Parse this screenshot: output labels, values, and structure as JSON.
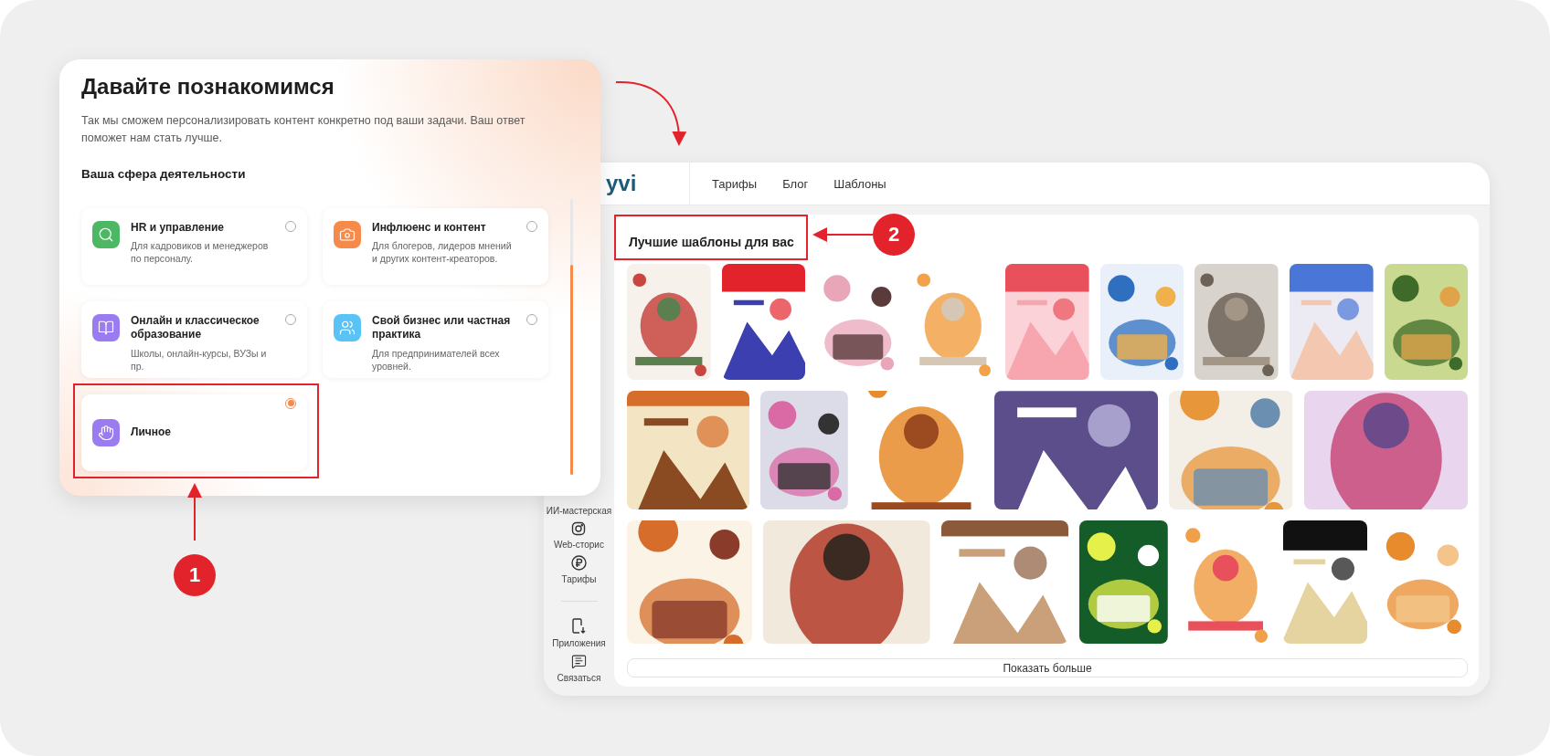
{
  "onboarding": {
    "title": "Давайте познакомимся",
    "subtitle": "Так мы сможем персонализировать контент конкретно под ваши задачи. Ваш ответ поможет нам стать лучше.",
    "section_title": "Ваша сфера деятельности",
    "options": [
      {
        "title": "HR и управление",
        "description": "Для кадровиков и менеджеров по персоналу.",
        "selected": false
      },
      {
        "title": "Инфлюенс и контент",
        "description": "Для блогеров, лидеров мнений и других контент-креаторов.",
        "selected": false
      },
      {
        "title": "Онлайн и классическое образование",
        "description": "Школы, онлайн-курсы, ВУЗы и пр.",
        "selected": false
      },
      {
        "title": "Свой бизнес или частная практика",
        "description": "Для предпринимателей всех уровней.",
        "selected": false
      },
      {
        "title": "Личное",
        "selected": true
      }
    ]
  },
  "app": {
    "logo": "yvi",
    "nav": [
      "Тарифы",
      "Блог",
      "Шаблоны"
    ],
    "sidebar": [
      {
        "label": "ИИ-мастерская"
      },
      {
        "label": "Web-сторис"
      },
      {
        "label": "Тарифы"
      },
      {
        "label": "Приложения"
      },
      {
        "label": "Связаться"
      }
    ],
    "section_title": "Лучшие шаблоны для вас",
    "show_more": "Показать больше"
  },
  "callouts": [
    {
      "number": "1"
    },
    {
      "number": "2"
    }
  ]
}
